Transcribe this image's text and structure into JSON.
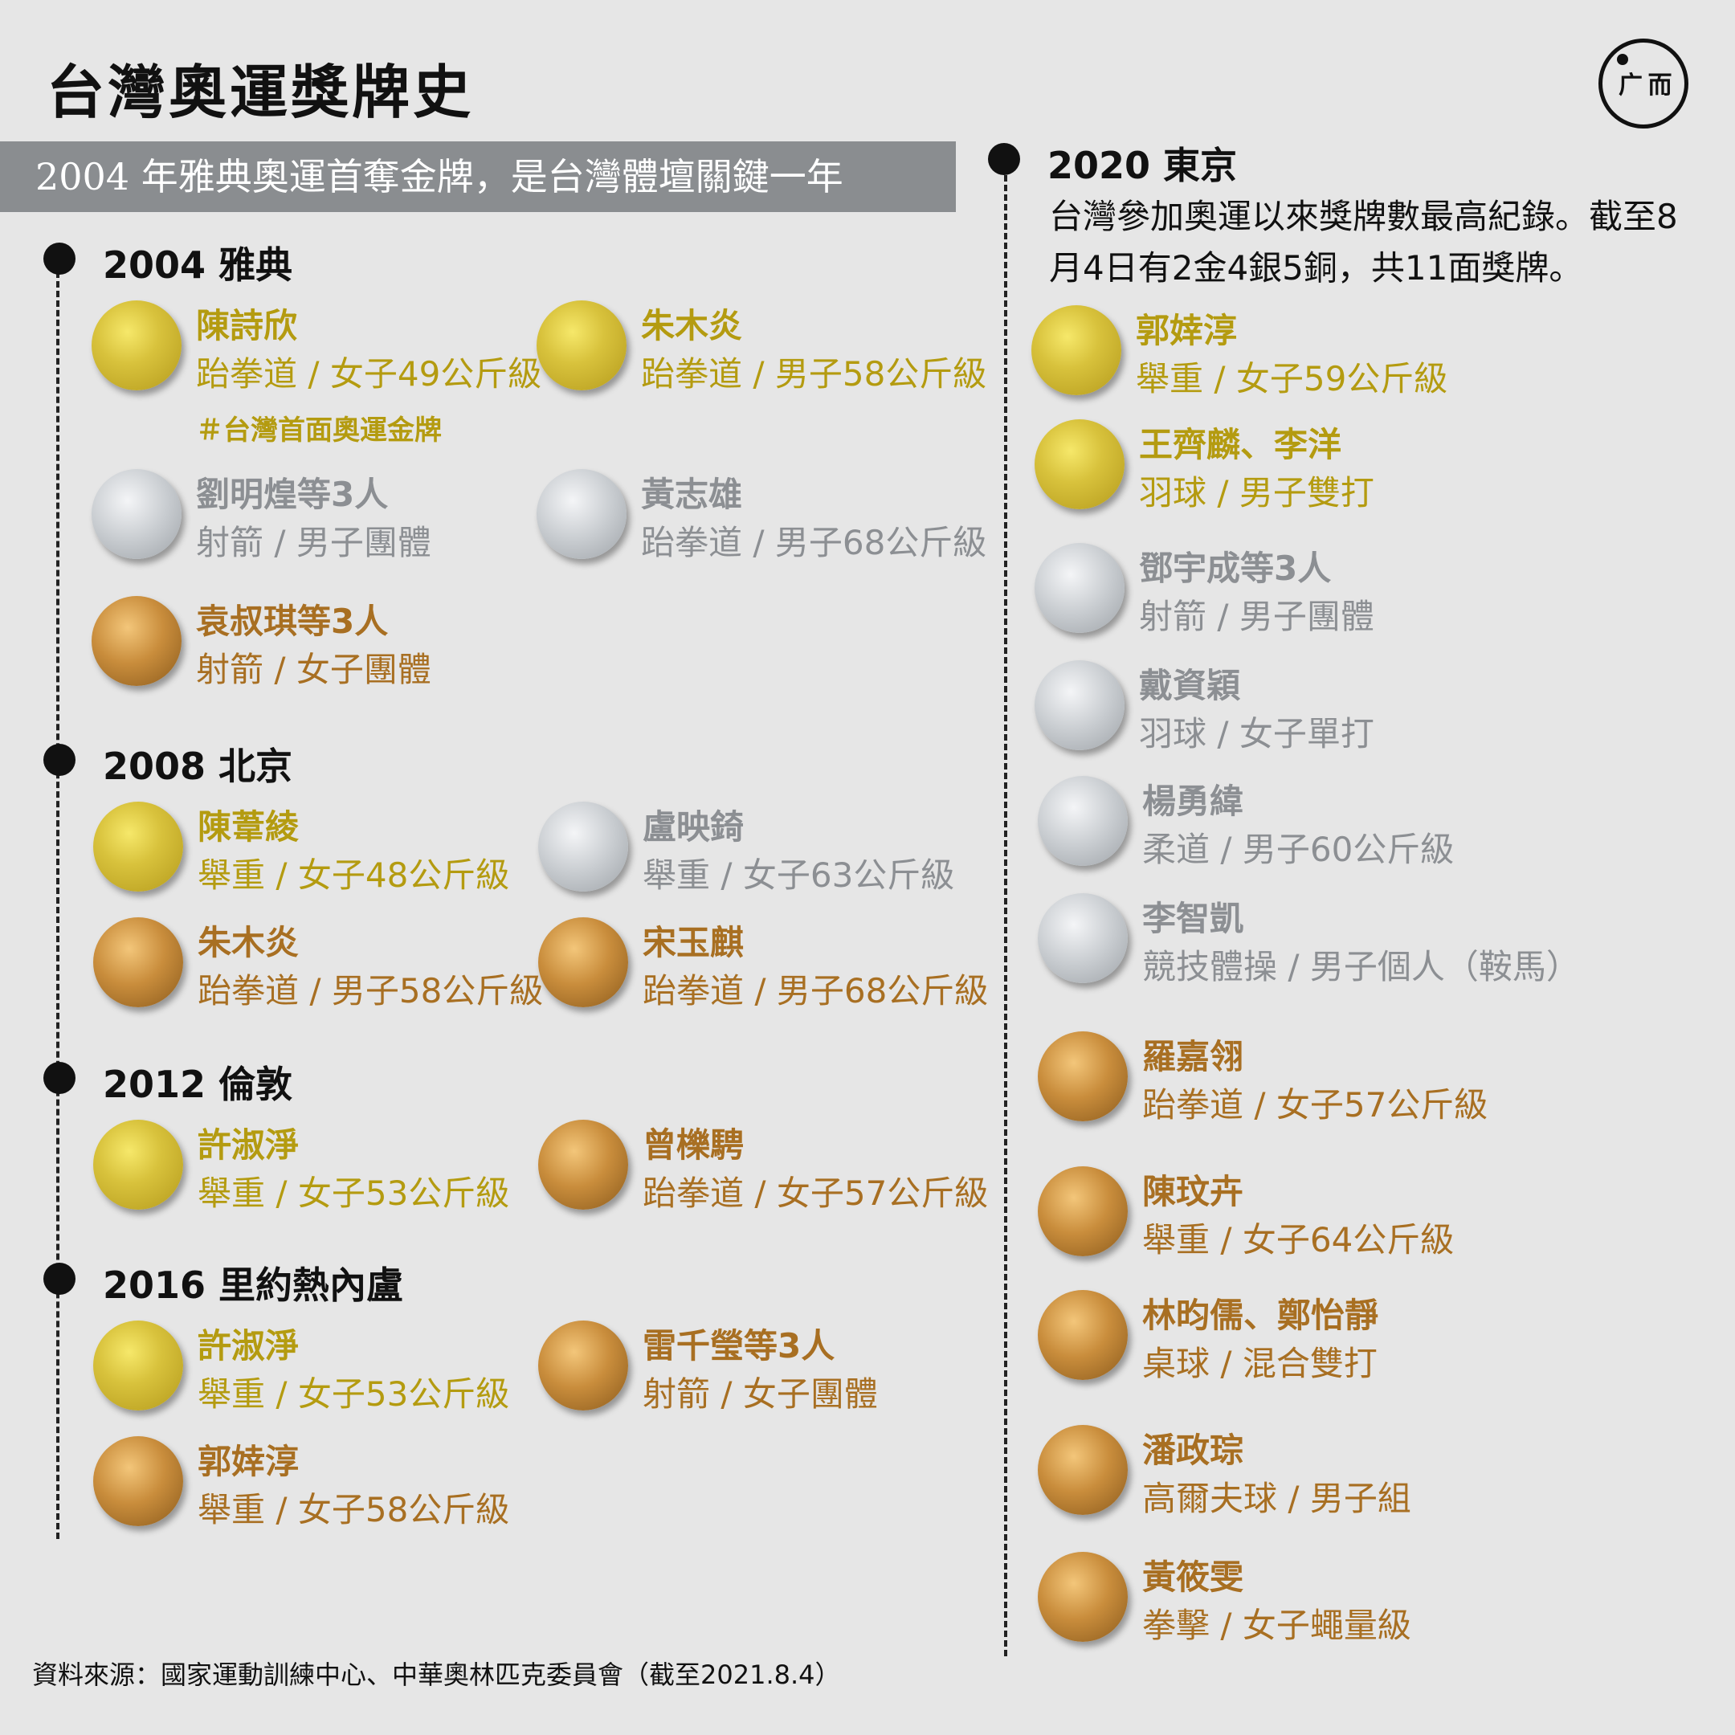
{
  "title": "台灣奧運獎牌史",
  "logo": {
    "mark": "广 而"
  },
  "banner": "2004 年雅典奧運首奪金牌，是台灣體壇關鍵一年",
  "years": {
    "athens": "2004 雅典",
    "beijing": "2008 北京",
    "london": "2012 倫敦",
    "rio": "2016 里約熱內盧",
    "tokyo": "2020 東京"
  },
  "tokyo_desc": "台灣參加奧運以來獎牌數最高紀錄。截至8月4日有2金4銀5銅，共11面獎牌。",
  "tag": "＃台灣首面奧運金牌",
  "colors": {
    "gold": "#b49b10",
    "silver": "#8c8f93",
    "bronze": "#a86f22",
    "banner": "#8a8d90"
  },
  "medals": {
    "a1": {
      "type": "gold",
      "name": "陳詩欣",
      "event": "跆拳道 / 女子49公斤級"
    },
    "a2": {
      "type": "gold",
      "name": "朱木炎",
      "event": "跆拳道 / 男子58公斤級"
    },
    "a3": {
      "type": "silver",
      "name": "劉明煌等3人",
      "event": "射箭 / 男子團體"
    },
    "a4": {
      "type": "silver",
      "name": "黃志雄",
      "event": "跆拳道 / 男子68公斤級"
    },
    "a5": {
      "type": "bronze",
      "name": "袁叔琪等3人",
      "event": "射箭 / 女子團體"
    },
    "b1": {
      "type": "gold",
      "name": "陳葦綾",
      "event": "舉重 / 女子48公斤級"
    },
    "b2": {
      "type": "silver",
      "name": "盧映錡",
      "event": "舉重 / 女子63公斤級"
    },
    "b3": {
      "type": "bronze",
      "name": "朱木炎",
      "event": "跆拳道 / 男子58公斤級"
    },
    "b4": {
      "type": "bronze",
      "name": "宋玉麒",
      "event": "跆拳道 / 男子68公斤級"
    },
    "c1": {
      "type": "gold",
      "name": "許淑淨",
      "event": "舉重 / 女子53公斤級"
    },
    "c2": {
      "type": "bronze",
      "name": "曾櫟騁",
      "event": "跆拳道 / 女子57公斤級"
    },
    "d1": {
      "type": "gold",
      "name": "許淑淨",
      "event": "舉重 / 女子53公斤級"
    },
    "d2": {
      "type": "bronze",
      "name": "雷千瑩等3人",
      "event": "射箭 / 女子團體"
    },
    "d3": {
      "type": "bronze",
      "name": "郭婞淳",
      "event": "舉重 / 女子58公斤級"
    },
    "t1": {
      "type": "gold",
      "name": "郭婞淳",
      "event": "舉重 / 女子59公斤級"
    },
    "t2": {
      "type": "gold",
      "name": "王齊麟、李洋",
      "event": "羽球 / 男子雙打"
    },
    "t3": {
      "type": "silver",
      "name": "鄧宇成等3人",
      "event": "射箭 / 男子團體"
    },
    "t4": {
      "type": "silver",
      "name": "戴資穎",
      "event": "羽球 / 女子單打"
    },
    "t5": {
      "type": "silver",
      "name": "楊勇緯",
      "event": "柔道 / 男子60公斤級"
    },
    "t6": {
      "type": "silver",
      "name": "李智凱",
      "event": "競技體操 / 男子個人（鞍馬）"
    },
    "t7": {
      "type": "bronze",
      "name": "羅嘉翎",
      "event": "跆拳道 / 女子57公斤級"
    },
    "t8": {
      "type": "bronze",
      "name": "陳玟卉",
      "event": "舉重 / 女子64公斤級"
    },
    "t9": {
      "type": "bronze",
      "name": "林昀儒、鄭怡靜",
      "event": "桌球 / 混合雙打"
    },
    "t10": {
      "type": "bronze",
      "name": "潘政琮",
      "event": "高爾夫球 / 男子組"
    },
    "t11": {
      "type": "bronze",
      "name": "黃筱雯",
      "event": "拳擊 / 女子蠅量級"
    }
  },
  "source": "資料來源：國家運動訓練中心、中華奧林匹克委員會（截至2021.8.4）"
}
